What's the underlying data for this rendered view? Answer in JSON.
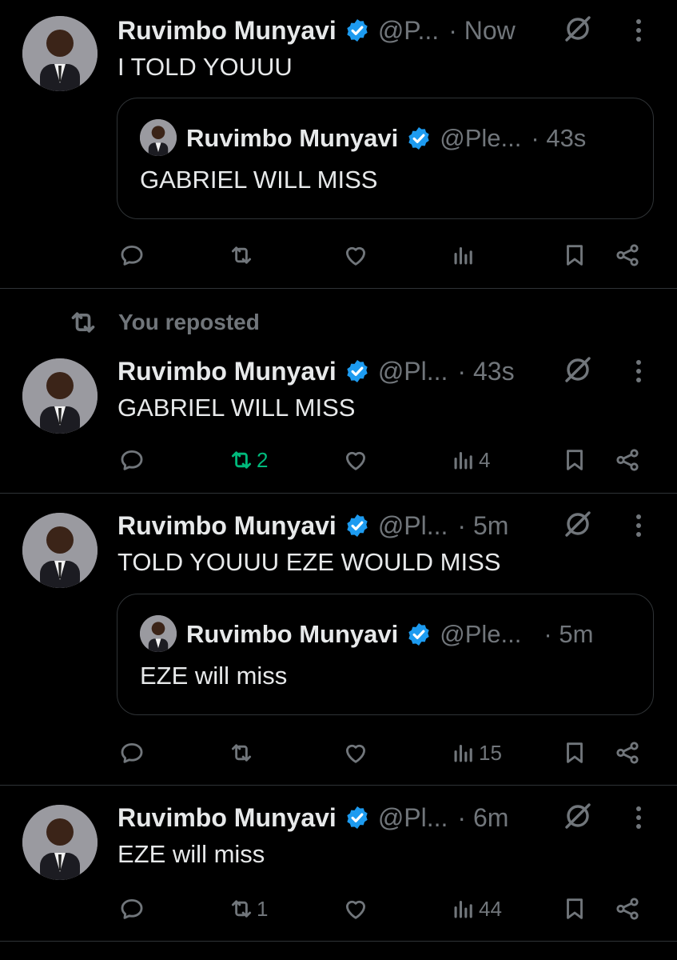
{
  "tweets": [
    {
      "name": "Ruvimbo Munyavi",
      "handle": "@P...",
      "time": "· Now",
      "text": "I TOLD YOUUU",
      "quote": {
        "name": "Ruvimbo Munyavi",
        "handle": "@Ple...",
        "time": "· 43s",
        "text": "GABRIEL WILL MISS"
      },
      "actions": {
        "reposts": "",
        "views": ""
      }
    },
    {
      "repost_context": "You reposted",
      "name": "Ruvimbo Munyavi",
      "handle": "@Pl...",
      "time": "· 43s",
      "text": "GABRIEL WILL MISS",
      "actions": {
        "reposts": "2",
        "views": "4"
      }
    },
    {
      "name": "Ruvimbo Munyavi",
      "handle": "@Pl...",
      "time": "· 5m",
      "text": "TOLD YOUUU EZE WOULD MISS",
      "quote": {
        "name": "Ruvimbo Munyavi",
        "handle": "@Ple...",
        "time": "· 5m",
        "text": "EZE will miss"
      },
      "actions": {
        "reposts": "",
        "views": "15"
      }
    },
    {
      "name": "Ruvimbo Munyavi",
      "handle": "@Pl...",
      "time": "· 6m",
      "text": "EZE will miss",
      "actions": {
        "reposts": "1",
        "views": "44"
      }
    }
  ],
  "icons": {
    "verified": "verified-badge-icon",
    "grok": "grok-icon",
    "more": "more-icon",
    "reply": "reply-icon",
    "repost": "repost-icon",
    "like": "like-icon",
    "views": "views-icon",
    "bookmark": "bookmark-icon",
    "share": "share-icon"
  },
  "colors": {
    "background": "#000000",
    "text": "#e7e9ea",
    "muted": "#71767b",
    "verified": "#1d9bf0",
    "repost_active": "#00ba7c",
    "divider": "#2f3336"
  }
}
